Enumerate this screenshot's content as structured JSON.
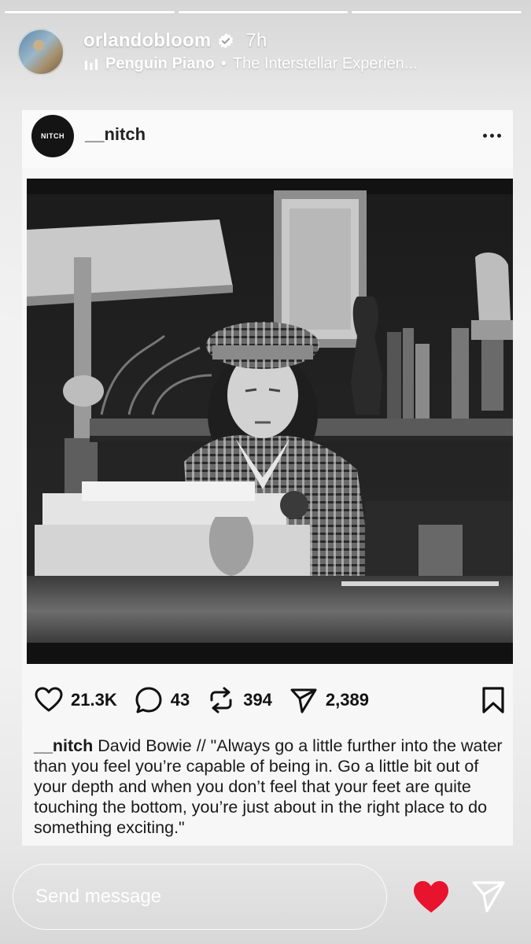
{
  "story": {
    "progress_segments": 3,
    "username": "orlandobloom",
    "time_ago": "7h",
    "music": {
      "artist": "Penguin Piano",
      "separator": "•",
      "track": "The Interstellar Experien..."
    }
  },
  "post": {
    "account": "__nitch",
    "logo_text": "NITCH",
    "stats": {
      "likes": "21.3K",
      "comments": "43",
      "reposts": "394",
      "shares": "2,389"
    },
    "caption_user": "__nitch",
    "caption_text": " David Bowie // \"Always go a little further into the water than you feel you’re capable of being in. Go a little bit out of your depth and when you don’t feel that your feet are quite touching the bottom, you’re just about in the right place to do something exciting.\""
  },
  "footer": {
    "send_placeholder": "Send message"
  },
  "colors": {
    "heart": "#e8132d",
    "verified": "#ffffff"
  }
}
